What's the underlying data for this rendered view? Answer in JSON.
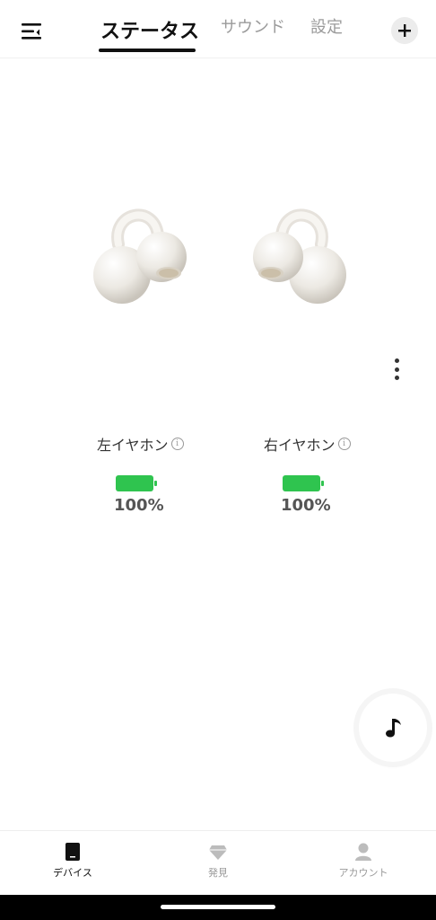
{
  "header": {
    "tabs": [
      {
        "label": "ステータス",
        "active": true
      },
      {
        "label": "サウンド",
        "active": false
      },
      {
        "label": "設定",
        "active": false
      }
    ],
    "menu_icon": "menu-icon",
    "add_icon": "plus-icon"
  },
  "earbuds": {
    "left": {
      "label": "左イヤホン",
      "battery_percent": "100%",
      "battery_level": 1.0
    },
    "right": {
      "label": "右イヤホン",
      "battery_percent": "100%",
      "battery_level": 1.0
    },
    "battery_color": "#2fc44f"
  },
  "bottom_nav": {
    "items": [
      {
        "label": "デバイス",
        "icon": "device-icon",
        "active": true
      },
      {
        "label": "発見",
        "icon": "diamond-icon",
        "active": false
      },
      {
        "label": "アカウント",
        "icon": "person-icon",
        "active": false
      }
    ]
  }
}
